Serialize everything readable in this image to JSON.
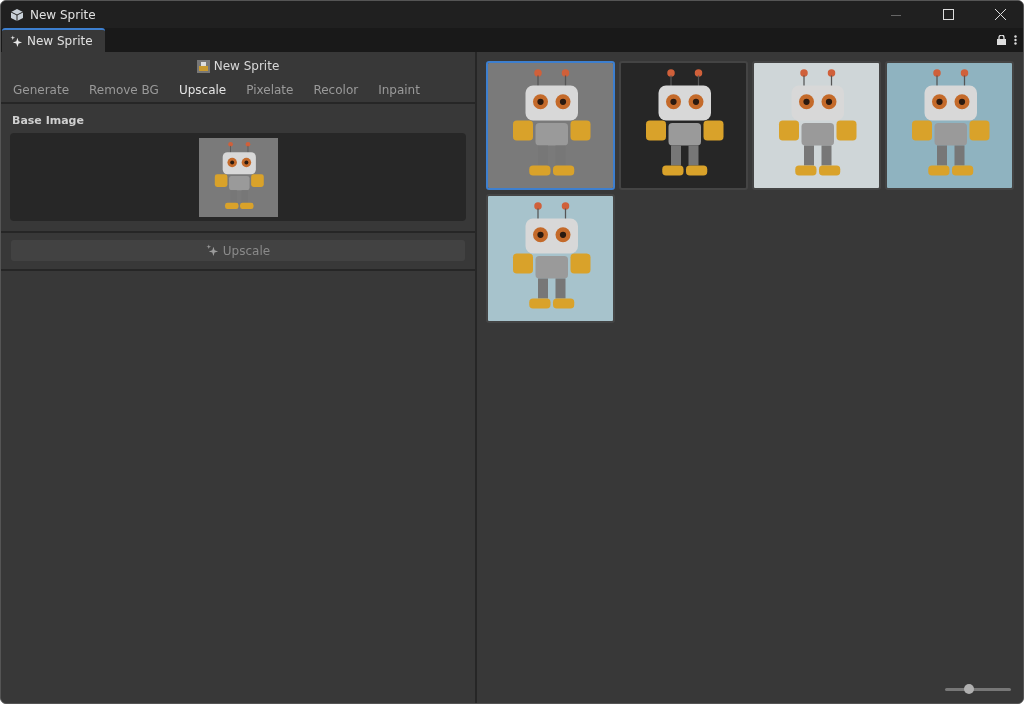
{
  "window": {
    "title": "New Sprite"
  },
  "doc_tab": {
    "label": "New Sprite",
    "selected": true
  },
  "panel": {
    "title": "New Sprite",
    "tabs": [
      {
        "label": "Generate",
        "selected": false
      },
      {
        "label": "Remove BG",
        "selected": false
      },
      {
        "label": "Upscale",
        "selected": true
      },
      {
        "label": "Pixelate",
        "selected": false
      },
      {
        "label": "Recolor",
        "selected": false
      },
      {
        "label": "Inpaint",
        "selected": false
      }
    ],
    "base_image_label": "Base Image",
    "action_button": {
      "label": "Upscale",
      "disabled": true
    }
  },
  "gallery": {
    "images": [
      {
        "selected": true
      },
      {
        "selected": false
      },
      {
        "selected": false
      },
      {
        "selected": false
      },
      {
        "selected": false
      }
    ],
    "zoom_slider": {
      "level": 0.37
    }
  }
}
